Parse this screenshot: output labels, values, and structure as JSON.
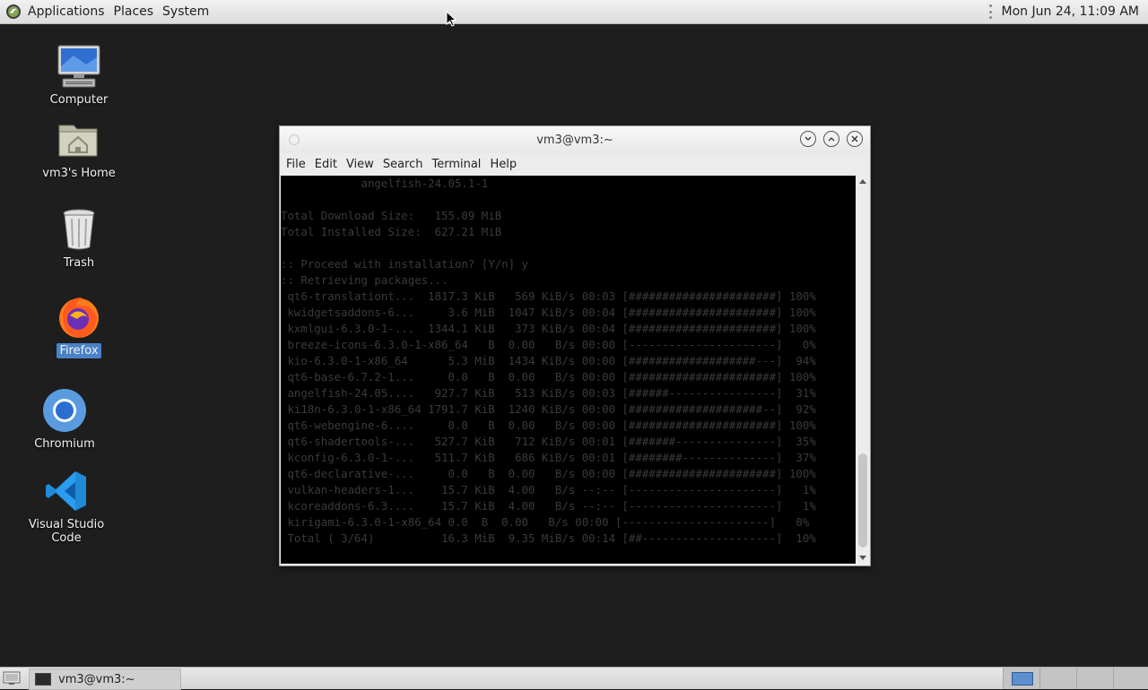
{
  "top_panel": {
    "menus": [
      "Applications",
      "Places",
      "System"
    ],
    "clock": "Mon Jun 24, 11:09 AM"
  },
  "desktop": {
    "icons": [
      {
        "label": "Computer"
      },
      {
        "label": "vm3's Home"
      },
      {
        "label": "Trash"
      },
      {
        "label": "Firefox"
      },
      {
        "label": "Chromium"
      },
      {
        "label": "Visual Studio Code"
      }
    ]
  },
  "terminal": {
    "title": "vm3@vm3:~",
    "menus": [
      "File",
      "Edit",
      "View",
      "Search",
      "Terminal",
      "Help"
    ],
    "lines": [
      "            angelfish-24.05.1-1",
      "",
      "Total Download Size:   155.09 MiB",
      "Total Installed Size:  627.21 MiB",
      "",
      ":: Proceed with installation? [Y/n] y",
      ":: Retrieving packages...",
      " qt6-translationt...  1817.3 KiB   569 KiB/s 00:03 [######################] 100%",
      " kwidgetsaddons-6...     3.6 MiB  1047 KiB/s 00:04 [######################] 100%",
      " kxmlgui-6.3.0-1-...  1344.1 KiB   373 KiB/s 00:04 [######################] 100%",
      " breeze-icons-6.3.0-1-x86_64   B  0.00   B/s 00:00 [----------------------]   0%",
      " kio-6.3.0-1-x86_64      5.3 MiB  1434 KiB/s 00:00 [###################---]  94%",
      " qt6-base-6.7.2-1...     0.0   B  0.00   B/s 00:00 [######################] 100%",
      " angelfish-24.05....   927.7 KiB   513 KiB/s 00:03 [######----------------]  31%",
      " ki18n-6.3.0-1-x86_64 1791.7 KiB  1240 KiB/s 00:00 [####################--]  92%",
      " qt6-webengine-6....     0.0   B  0.00   B/s 00:00 [######################] 100%",
      " qt6-shadertools-...   527.7 KiB   712 KiB/s 00:01 [#######---------------]  35%",
      " kconfig-6.3.0-1-...   511.7 KiB   686 KiB/s 00:01 [########--------------]  37%",
      " qt6-declarative-...     0.0   B  0.00   B/s 00:00 [######################] 100%",
      " vulkan-headers-1...    15.7 KiB  4.00   B/s --:-- [----------------------]   1%",
      " kcoreaddons-6.3....    15.7 KiB  4.00   B/s --:-- [----------------------]   1%",
      " kirigami-6.3.0-1-x86_64 0.0  B  0.00   B/s 00:00 [----------------------]   0%",
      " Total ( 3/64)          16.3 MiB  9.35 MiB/s 00:14 [##--------------------]  10%"
    ]
  },
  "bottom_panel": {
    "task_label": "vm3@vm3:~"
  },
  "colors": {
    "desktop_bg": "#1d1e1d",
    "selection": "#4a82c8"
  }
}
